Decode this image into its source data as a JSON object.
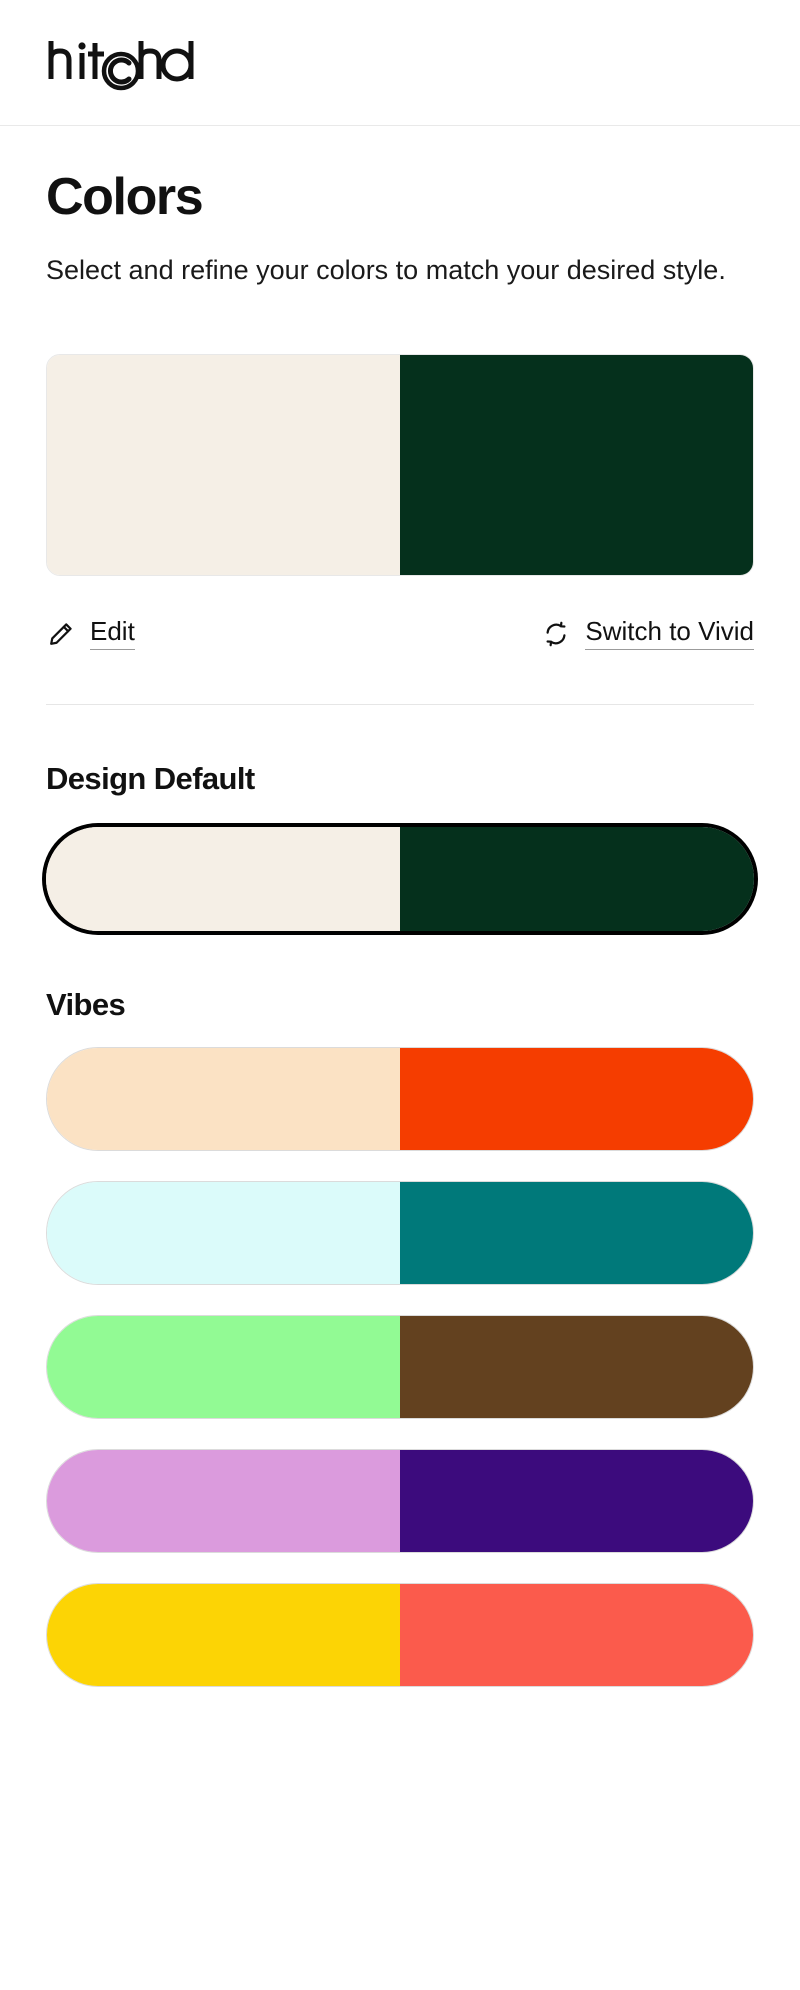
{
  "brand": {
    "logo_text": "hitchd"
  },
  "header": {
    "title": "Colors",
    "subtitle": "Select and refine your colors to match your desired style."
  },
  "current_palette": {
    "name": "Design Default",
    "light": "#F5EFE6",
    "dark": "#05301C"
  },
  "actions": {
    "edit": {
      "label": "Edit",
      "icon": "pencil-icon"
    },
    "switch": {
      "label": "Switch to Vivid",
      "icon": "refresh-icon"
    }
  },
  "sections": {
    "design_default_heading": "Design Default",
    "vibes_heading": "Vibes"
  },
  "design_default_swatch": {
    "light": "#F5EFE6",
    "dark": "#05301C",
    "selected": true
  },
  "vibes": [
    {
      "name": "peach-orange",
      "light": "#FBE2C4",
      "dark": "#F53D00",
      "selected": false
    },
    {
      "name": "ice-teal",
      "light": "#DBFBFA",
      "dark": "#00797A",
      "selected": false
    },
    {
      "name": "mint-brown",
      "light": "#92FA94",
      "dark": "#63411F",
      "selected": false
    },
    {
      "name": "lilac-violet",
      "light": "#DB9BDD",
      "dark": "#3C0B7D",
      "selected": false
    },
    {
      "name": "yellow-coral",
      "light": "#FCD405",
      "dark": "#FB5B4C",
      "selected": false
    }
  ]
}
